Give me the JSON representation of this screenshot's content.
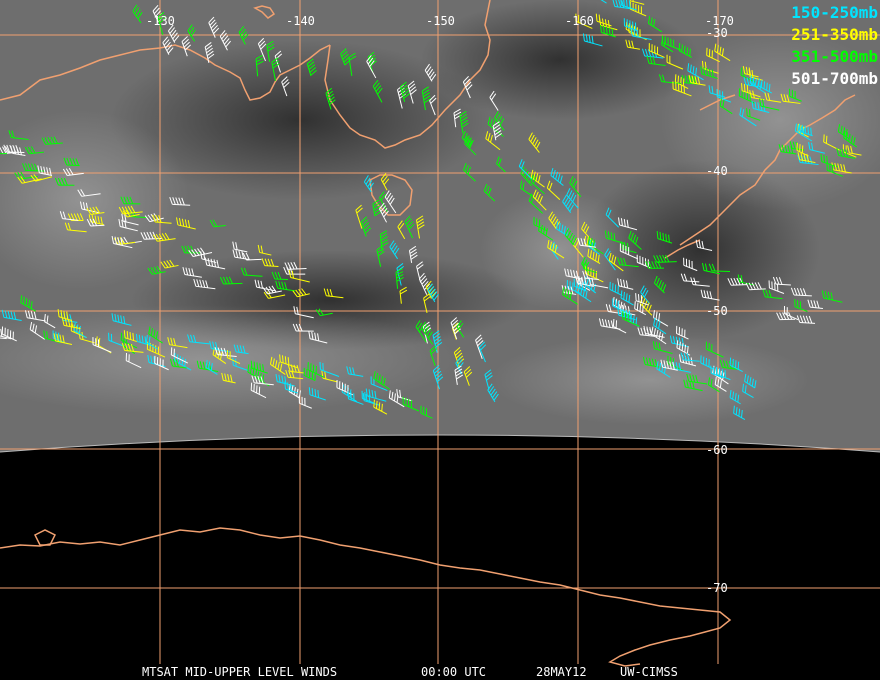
{
  "legend": [
    {
      "label": "150-250mb",
      "color": "#00e5ff"
    },
    {
      "label": "251-350mb",
      "color": "#ffff00"
    },
    {
      "label": "351-500mb",
      "color": "#00ff00"
    },
    {
      "label": "501-700mb",
      "color": "#ffffff"
    }
  ],
  "longitude_labels": [
    "-130",
    "-140",
    "-150",
    "-160",
    "-170"
  ],
  "latitude_labels": [
    "-30",
    "-40",
    "-50",
    "-60",
    "-70"
  ],
  "footer": {
    "product": "MTSAT MID-UPPER LEVEL WINDS",
    "time": "00:00 UTC",
    "date": "28MAY12",
    "source": "UW-CIMSS"
  },
  "colors": {
    "grid": "#f0a070",
    "coast": "#f0a070",
    "space": "#000000"
  }
}
